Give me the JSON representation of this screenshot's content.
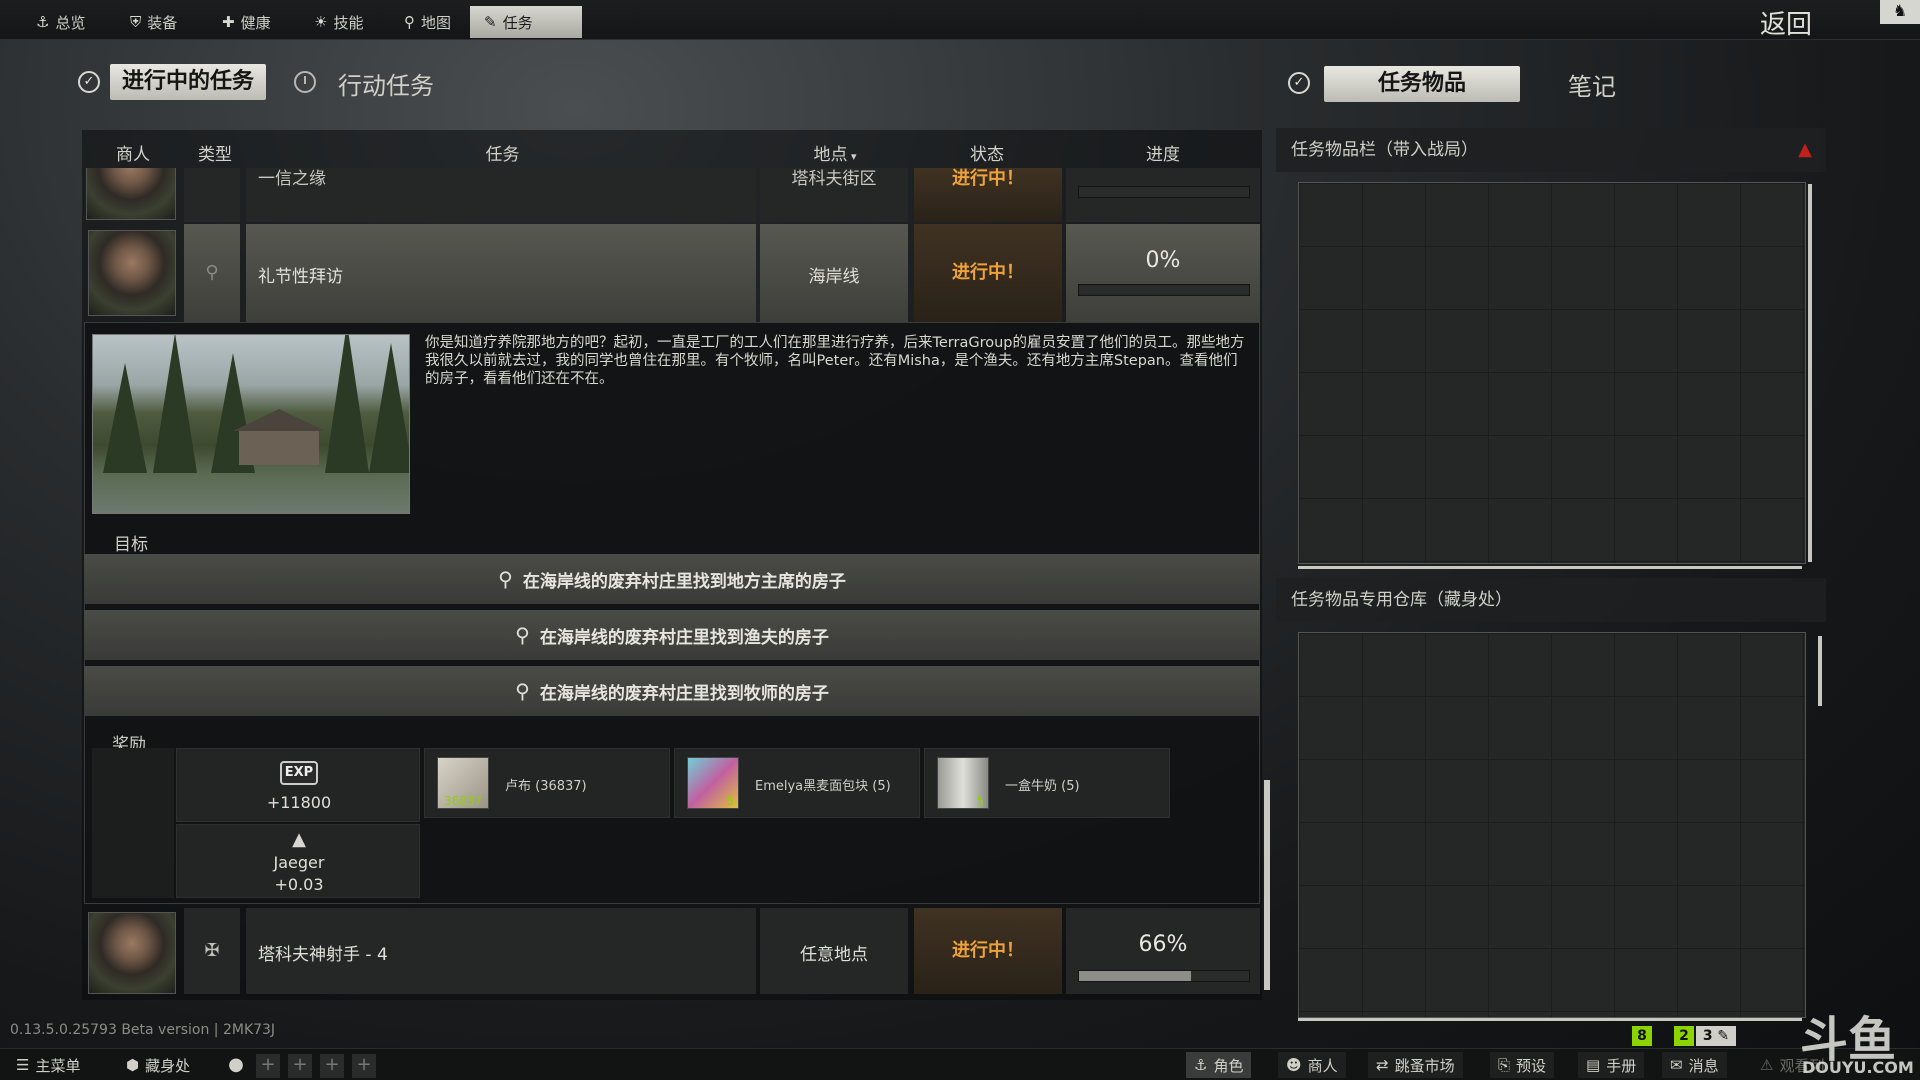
{
  "top_tabs": [
    {
      "icon": "⚓",
      "label": "总览"
    },
    {
      "icon": "⛨",
      "label": "装备"
    },
    {
      "icon": "✚",
      "label": "健康"
    },
    {
      "icon": "☀",
      "label": "技能"
    },
    {
      "icon": "⚲",
      "label": "地图"
    },
    {
      "icon": "✎",
      "label": "任务"
    }
  ],
  "back_label": "返回",
  "section_tabs": {
    "active_quests": "进行中的任务",
    "operation_tasks": "行动任务",
    "quest_items": "任务物品",
    "notes": "笔记"
  },
  "table": {
    "headers": {
      "trader": "商人",
      "type": "类型",
      "quest": "任务",
      "location": "地点",
      "status": "状态",
      "progress": "进度"
    },
    "rows": [
      {
        "quest": "一信之缘",
        "location": "塔科夫街区",
        "status": "进行中！",
        "progress_label": "",
        "progress": 0
      },
      {
        "quest": "礼节性拜访",
        "location": "海岸线",
        "status": "进行中！",
        "progress_label": "0%",
        "progress": 0
      },
      {
        "quest": "塔科夫神射手 - 4",
        "location": "任意地点",
        "status": "进行中！",
        "progress_label": "66%",
        "progress": 0.66
      }
    ]
  },
  "detail": {
    "description": "你是知道疗养院那地方的吧？起初，一直是工厂的工人们在那里进行疗养，后来TerraGroup的雇员安置了他们的员工。那些地方我很久以前就去过，我的同学也曾住在那里。有个牧师，名叫Peter。还有Misha，是个渔夫。还有地方主席Stepan。查看他们的房子，看看他们还在不在。",
    "objectives_label": "目标",
    "objectives": [
      "在海岸线的废弃村庄里找到地方主席的房子",
      "在海岸线的废弃村庄里找到渔夫的房子",
      "在海岸线的废弃村庄里找到牧师的房子"
    ],
    "rewards_label": "奖励",
    "rewards": {
      "exp_badge": "EXP",
      "exp_value": "+11800",
      "rep_trader": "Jaeger",
      "rep_value": "+0.03",
      "items": [
        {
          "name": "卢布 (36837)",
          "count": "36837"
        },
        {
          "name": "Emelya黑麦面包块 (5)",
          "count": "5"
        },
        {
          "name": "一盒牛奶 (5)",
          "count": "5"
        }
      ]
    }
  },
  "right_panel": {
    "stash_title": "任务物品栏（带入战局）",
    "storage_title": "任务物品专用仓库（藏身处）"
  },
  "version": "0.13.5.0.25793 Beta version | 2MK73J",
  "bottom_left": {
    "main_menu": "主菜单",
    "hideout": "藏身处"
  },
  "bottom_right": [
    "角色",
    "商人",
    "跳蚤市场",
    "预设",
    "手册",
    "消息",
    "观看列"
  ],
  "badges": [
    "8",
    "2",
    "3"
  ],
  "watermark": "斗鱼",
  "watermark_sub": "DOUYU.COM",
  "colors": {
    "status_orange": "#f0a23a",
    "badge_green": "#8cd400",
    "alert_red": "#c0201a"
  }
}
